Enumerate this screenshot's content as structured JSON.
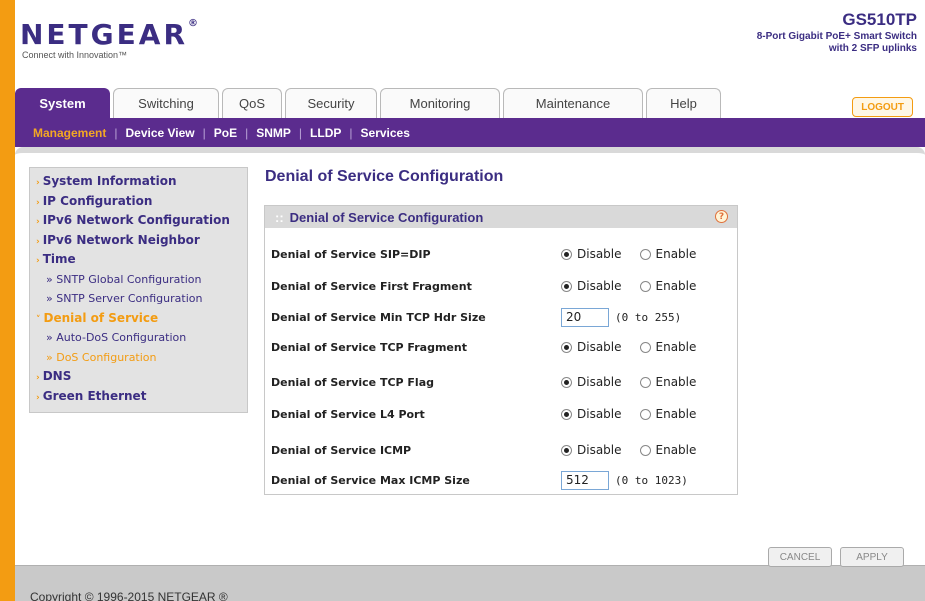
{
  "brand": {
    "logo": "NETGEAR",
    "reg": "®",
    "tagline": "Connect with Innovation™"
  },
  "device": {
    "model": "GS510TP",
    "desc_line1": "8-Port Gigabit PoE+ Smart Switch",
    "desc_line2": "with 2 SFP uplinks"
  },
  "tabs": [
    {
      "label": "System"
    },
    {
      "label": "Switching"
    },
    {
      "label": "QoS"
    },
    {
      "label": "Security"
    },
    {
      "label": "Monitoring"
    },
    {
      "label": "Maintenance"
    },
    {
      "label": "Help"
    }
  ],
  "logout_label": "LOGOUT",
  "subnav": [
    {
      "label": "Management"
    },
    {
      "label": "Device View"
    },
    {
      "label": "PoE"
    },
    {
      "label": "SNMP"
    },
    {
      "label": "LLDP"
    },
    {
      "label": "Services"
    }
  ],
  "leftnav": [
    {
      "label": "System Information"
    },
    {
      "label": "IP Configuration"
    },
    {
      "label": "IPv6 Network Configuration"
    },
    {
      "label": "IPv6 Network Neighbor"
    },
    {
      "label": "Time"
    },
    {
      "label": "» SNTP Global Configuration"
    },
    {
      "label": "» SNTP Server Configuration"
    },
    {
      "label": "Denial of Service"
    },
    {
      "label": "» Auto-DoS Configuration"
    },
    {
      "label": "» DoS Configuration"
    },
    {
      "label": "DNS"
    },
    {
      "label": "Green Ethernet"
    }
  ],
  "page": {
    "title": "Denial of Service Configuration",
    "box_title": "Denial of Service Configuration",
    "help": "?"
  },
  "radio_labels": {
    "disable": "Disable",
    "enable": "Enable"
  },
  "rows": [
    {
      "label": "Denial of Service SIP=DIP",
      "value": "Disable"
    },
    {
      "label": "Denial of Service First Fragment",
      "value": "Disable"
    },
    {
      "label": "Denial of Service Min TCP Hdr Size",
      "input": "20",
      "range": "(0 to 255)"
    },
    {
      "label": "Denial of Service TCP Fragment",
      "value": "Disable"
    },
    {
      "label": "Denial of Service TCP Flag",
      "value": "Disable"
    },
    {
      "label": "Denial of Service L4 Port",
      "value": "Disable"
    },
    {
      "label": "Denial of Service ICMP",
      "value": "Disable"
    },
    {
      "label": "Denial of Service Max ICMP Size",
      "input": "512",
      "range": "(0 to 1023)"
    }
  ],
  "buttons": {
    "cancel": "CANCEL",
    "apply": "APPLY"
  },
  "copyright": "Copyright © 1996-2015 NETGEAR ®",
  "colors": {
    "purple": "#5b2c8e",
    "orange": "#f39c12",
    "navy": "#3b2d82"
  }
}
